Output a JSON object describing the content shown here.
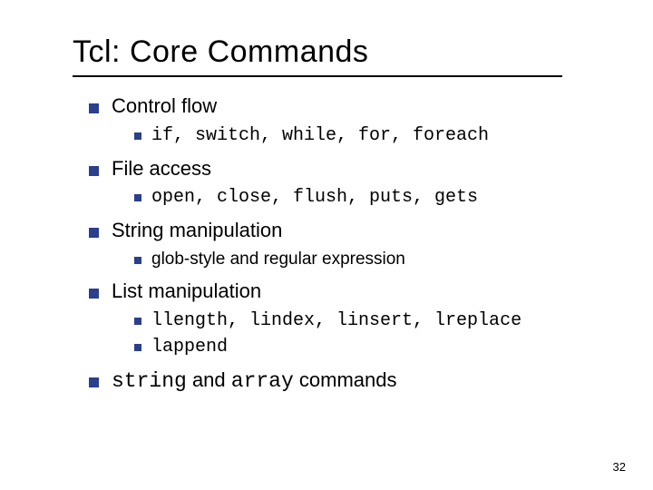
{
  "title": "Tcl: Core Commands",
  "sections": {
    "control_flow": {
      "label": "Control flow",
      "sub": "if, switch, while, for, foreach"
    },
    "file_access": {
      "label": "File access",
      "sub": "open, close, flush, puts, gets"
    },
    "string_manip": {
      "label": "String manipulation",
      "sub": "glob-style and regular expression"
    },
    "list_manip": {
      "label": "List manipulation",
      "sub1": "llength, lindex, linsert, lreplace",
      "sub2": "lappend"
    },
    "cmds": {
      "string_kw": "string",
      "and_txt": " and ",
      "array_kw": "array",
      "commands_txt": " commands"
    }
  },
  "page_number": "32"
}
